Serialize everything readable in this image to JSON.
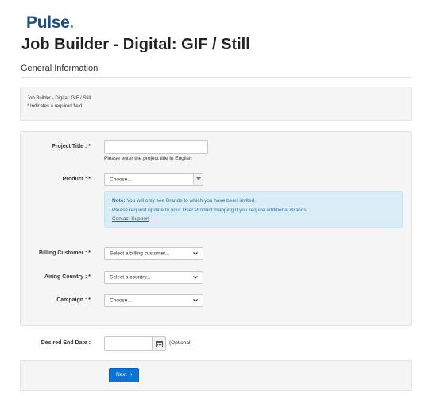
{
  "brand": {
    "logo_text": "Pulse"
  },
  "page": {
    "title": "Job Builder - Digital: GIF / Still"
  },
  "section": {
    "heading": "General Information"
  },
  "info_panel": {
    "line1": "Job Builder - Digital: GIF / Still",
    "line2": "* Indicates a required field"
  },
  "form": {
    "project_title": {
      "label": "Project Title : *",
      "value": "",
      "help": "Please enter the project title in English"
    },
    "product": {
      "label": "Product : *",
      "selected": "Choose..."
    },
    "note": {
      "bold": "Note:",
      "line1": " You will only see Brands to which you have been invited.",
      "line2": "Please request update to your User Product mapping if you require additional Brands.",
      "link": "Contact Support"
    },
    "billing_customer": {
      "label": "Billing Customer : *",
      "selected": "Select a billing customer..."
    },
    "airing_country": {
      "label": "Airing Country : *",
      "selected": "Select a country..."
    },
    "campaign": {
      "label": "Campaign : *",
      "selected": "Choose..."
    },
    "desired_end_date": {
      "label": "Desired End Date :",
      "value": "",
      "optional": "(Optional)"
    }
  },
  "actions": {
    "next_label": "Next",
    "next_arrow": "›"
  },
  "colors": {
    "brand": "#1f4e79",
    "primary_button": "#1173d1",
    "note_bg": "#d9edf7",
    "note_text": "#31708f"
  }
}
